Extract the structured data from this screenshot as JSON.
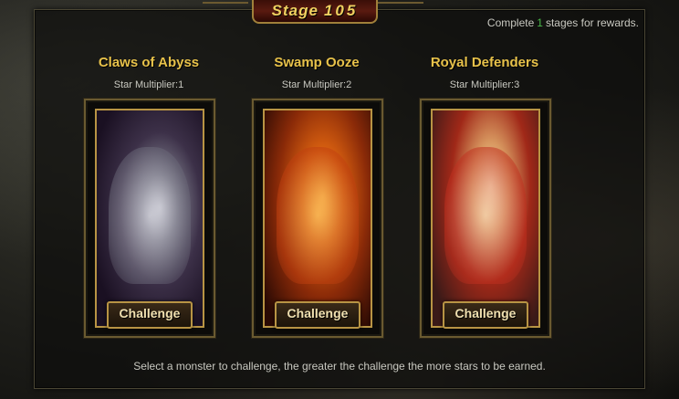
{
  "stage": {
    "label": "Stage",
    "number": "105"
  },
  "rewards": {
    "prefix": "Complete",
    "count": "1",
    "suffix": "stages for rewards."
  },
  "monsters": [
    {
      "name": "Claws of Abyss",
      "multiplier": "Star Multiplier:1",
      "button": "Challenge",
      "art_icon": "werewolf-art"
    },
    {
      "name": "Swamp Ooze",
      "multiplier": "Star Multiplier:2",
      "button": "Challenge",
      "art_icon": "ooze-monster-art"
    },
    {
      "name": "Royal Defenders",
      "multiplier": "Star Multiplier:3",
      "button": "Challenge",
      "art_icon": "armored-heroine-art"
    }
  ],
  "hint": "Select a monster to challenge, the greater the challenge the more stars to be earned.",
  "colors": {
    "title_gold": "#e8c24a",
    "reward_green": "#4ab84a",
    "frame_gold": "#b89444"
  }
}
